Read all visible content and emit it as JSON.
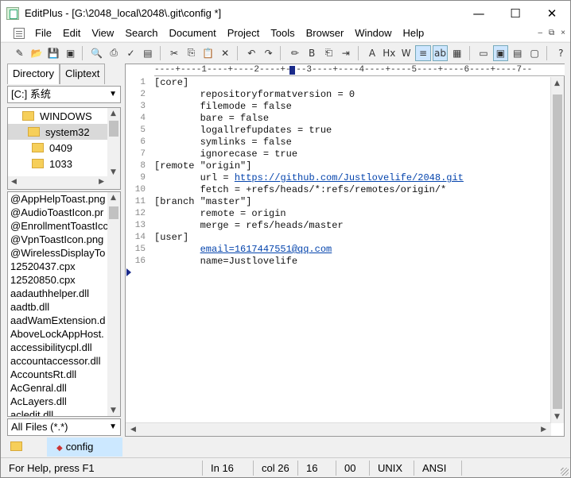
{
  "titlebar": {
    "title": "EditPlus - [G:\\2048_local\\2048\\.git\\config *]",
    "minimize": "—",
    "maximize": "☐",
    "close": "✕"
  },
  "menubar": {
    "items": [
      "File",
      "Edit",
      "View",
      "Search",
      "Document",
      "Project",
      "Tools",
      "Browser",
      "Window",
      "Help"
    ],
    "mdi_controls": [
      "–",
      "⧉",
      "×"
    ]
  },
  "toolbar": {
    "buttons": [
      "new-file-icon",
      "open-icon",
      "save-icon",
      "save-all-icon",
      "sep",
      "print-preview-icon",
      "print-icon",
      "spell-check-icon",
      "html-preview-icon",
      "sep",
      "cut-icon",
      "copy-icon",
      "paste-icon",
      "delete-icon",
      "sep",
      "undo-icon",
      "redo-icon",
      "sep",
      "find-icon",
      "replace-icon",
      "find-in-files-icon",
      "goto-icon",
      "sep",
      "font-icon",
      "hex-icon",
      "word-wrap-icon",
      "indent-icon",
      "line-number-icon",
      "ruler-icon",
      "sep",
      "window-1-icon",
      "window-2-icon",
      "window-3-icon",
      "window-4-icon",
      "sep",
      "help-icon"
    ],
    "glyphs": [
      "✎",
      "📂",
      "💾",
      "▣",
      "|",
      "🔍",
      "⎙",
      "✓",
      "▤",
      "|",
      "✂",
      "⎘",
      "📋",
      "✕",
      "|",
      "↶",
      "↷",
      "|",
      "✏",
      "B",
      "⎗",
      "⇥",
      "|",
      "A",
      "Hx",
      "W",
      "≡",
      "ab",
      "▦",
      "|",
      "▭",
      "▣",
      "▤",
      "▢",
      "|",
      "?"
    ]
  },
  "sidebar": {
    "tabs": [
      "Directory",
      "Cliptext"
    ],
    "drive": "[C:] 系统",
    "tree": [
      "WINDOWS",
      "system32",
      "0409",
      "1033"
    ],
    "files": [
      "@AppHelpToast.png",
      "@AudioToastIcon.pr",
      "@EnrollmentToastIcc",
      "@VpnToastIcon.png",
      "@WirelessDisplayTo",
      "12520437.cpx",
      "12520850.cpx",
      "aadauthhelper.dll",
      "aadtb.dll",
      "aadWamExtension.d",
      "AboveLockAppHost.",
      "accessibilitycpl.dll",
      "accountaccessor.dll",
      "AccountsRt.dll",
      "AcGenral.dll",
      "AcLayers.dll",
      "acledit.dll"
    ],
    "filter": "All Files (*.*)"
  },
  "doc_tab": {
    "name": "config"
  },
  "editor": {
    "ruler": "----+----1----+----2----+----3----+----4----+----5----+----6----+----7--",
    "lines": [
      {
        "n": "1",
        "text": "[core]"
      },
      {
        "n": "2",
        "text": "        repositoryformatversion = 0"
      },
      {
        "n": "3",
        "text": "        filemode = false"
      },
      {
        "n": "4",
        "text": "        bare = false"
      },
      {
        "n": "5",
        "text": "        logallrefupdates = true"
      },
      {
        "n": "6",
        "text": "        symlinks = false"
      },
      {
        "n": "7",
        "text": "        ignorecase = true"
      },
      {
        "n": "8",
        "text": "[remote \"origin\"]"
      },
      {
        "n": "9",
        "pre": "        url = ",
        "link": "https://github.com/Justlovelife/2048.git"
      },
      {
        "n": "10",
        "text": "        fetch = +refs/heads/*:refs/remotes/origin/*"
      },
      {
        "n": "11",
        "text": "[branch \"master\"]"
      },
      {
        "n": "12",
        "text": "        remote = origin"
      },
      {
        "n": "13",
        "text": "        merge = refs/heads/master"
      },
      {
        "n": "14",
        "text": "[user]"
      },
      {
        "n": "15",
        "pre": "        ",
        "link": "email=1617447551@qq.com"
      },
      {
        "n": "16",
        "text": "        name=Justlovelife"
      }
    ]
  },
  "statusbar": {
    "help": "For Help, press F1",
    "line": "In 16",
    "col": "col 26",
    "num": "16",
    "code": "00",
    "eol": "UNIX",
    "encoding": "ANSI"
  }
}
